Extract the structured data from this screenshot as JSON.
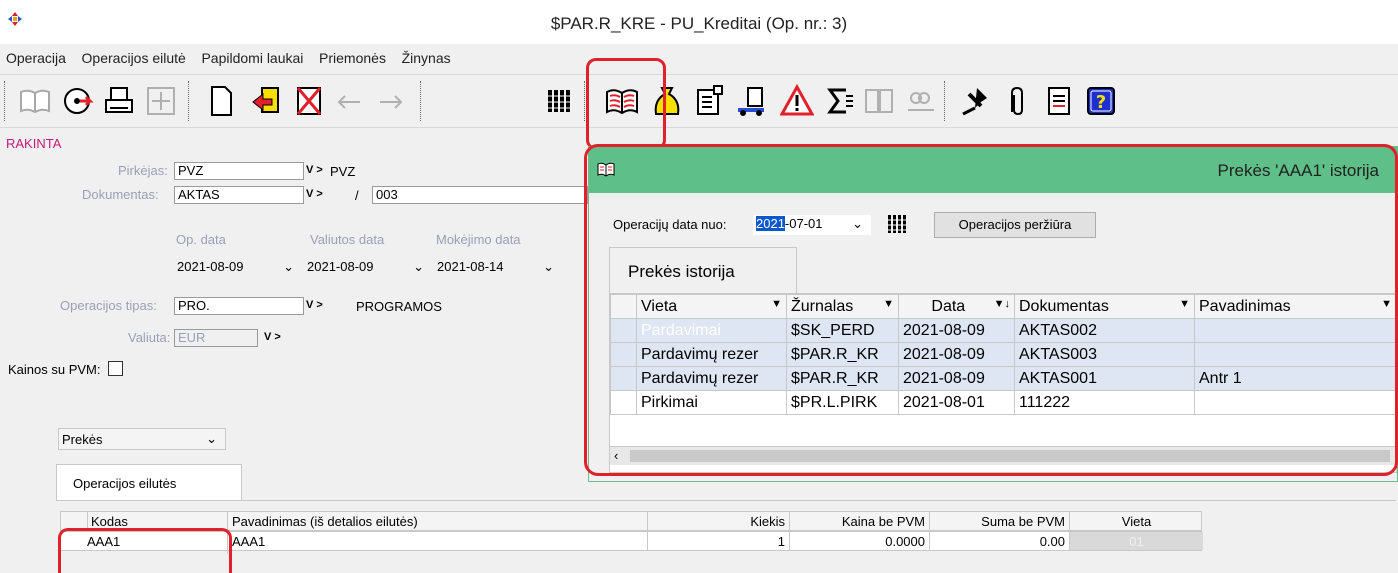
{
  "window": {
    "title": "$PAR.R_KRE - PU_Kreditai (Op. nr.: 3)"
  },
  "menu": [
    "Operacija",
    "Operacijos eilutė",
    "Papildomi laukai",
    "Priemonės",
    "Žinynas"
  ],
  "toolbar": {
    "icons": [
      "book-open-icon",
      "cd-back-icon",
      "printer-icon",
      "move-icon",
      "new-doc-icon",
      "open-doc-icon",
      "delete-doc-icon",
      "undo-icon",
      "redo-icon",
      "columns-icon",
      "history-book-icon",
      "money-bag-icon",
      "doc-edit-icon",
      "delivery-icon",
      "warning-icon",
      "sum-icon",
      "split-icon",
      "link-icon",
      "pin-icon",
      "paperclip-icon",
      "document-icon",
      "help-icon"
    ]
  },
  "form": {
    "status": "RAKINTA",
    "buyer_label": "Pirkėjas:",
    "buyer_value": "PVZ",
    "buyer_name": "PVZ",
    "doc_label": "Dokumentas:",
    "doc_value": "AKTAS",
    "doc_sep": "/",
    "doc_number": "003",
    "op_date_label": "Op. data",
    "cur_date_label": "Valiutos data",
    "pay_date_label": "Mokėjimo data",
    "op_date": "2021-08-09",
    "cur_date": "2021-08-09",
    "pay_date": "2021-08-14",
    "optype_label": "Operacijos tipas:",
    "optype_value": "PRO.",
    "optype_name": "PROGRAMOS",
    "currency_label": "Valiuta:",
    "currency_value": "EUR",
    "vat_label": "Kainos su PVM:",
    "combo_value": "Prekės",
    "vv": "V >"
  },
  "lines": {
    "tab_label": "Operacijos eilutės",
    "headers": [
      "Kodas",
      "Pavadinimas (iš detalios eilutės)",
      "Kiekis",
      "Kaina be PVM",
      "Suma be PVM",
      "Vieta"
    ],
    "rows": [
      [
        "AAA1",
        "AAA1",
        "1",
        "0.0000",
        "0.00",
        "01"
      ]
    ]
  },
  "dialog": {
    "title": "Prekės 'AAA1' istorija",
    "date_label": "Operacijų data nuo:",
    "date_value_sel": "2021",
    "date_value_rest": "-07-01",
    "review_button": "Operacijos peržiūra",
    "tab_label": "Prekės istorija",
    "headers": [
      "Vieta",
      "Žurnalas",
      "Data",
      "Dokumentas",
      "Pavadinimas"
    ],
    "rows": [
      [
        "Pardavimai",
        "$SK_PERD",
        "2021-08-09",
        "AKTAS002",
        ""
      ],
      [
        "Pardavimų rezer",
        "$PAR.R_KR",
        "2021-08-09",
        "AKTAS003",
        ""
      ],
      [
        "Pardavimų rezer",
        "$PAR.R_KR",
        "2021-08-09",
        "AKTAS001",
        "Antr 1"
      ],
      [
        "Pirkimai",
        "$PR.L.PIRK",
        "2021-08-01",
        "111222",
        ""
      ]
    ]
  },
  "colors": {
    "highlight": "#e0202a",
    "dialog_header": "#5fbf88",
    "row_selected": "#dde6f2"
  }
}
